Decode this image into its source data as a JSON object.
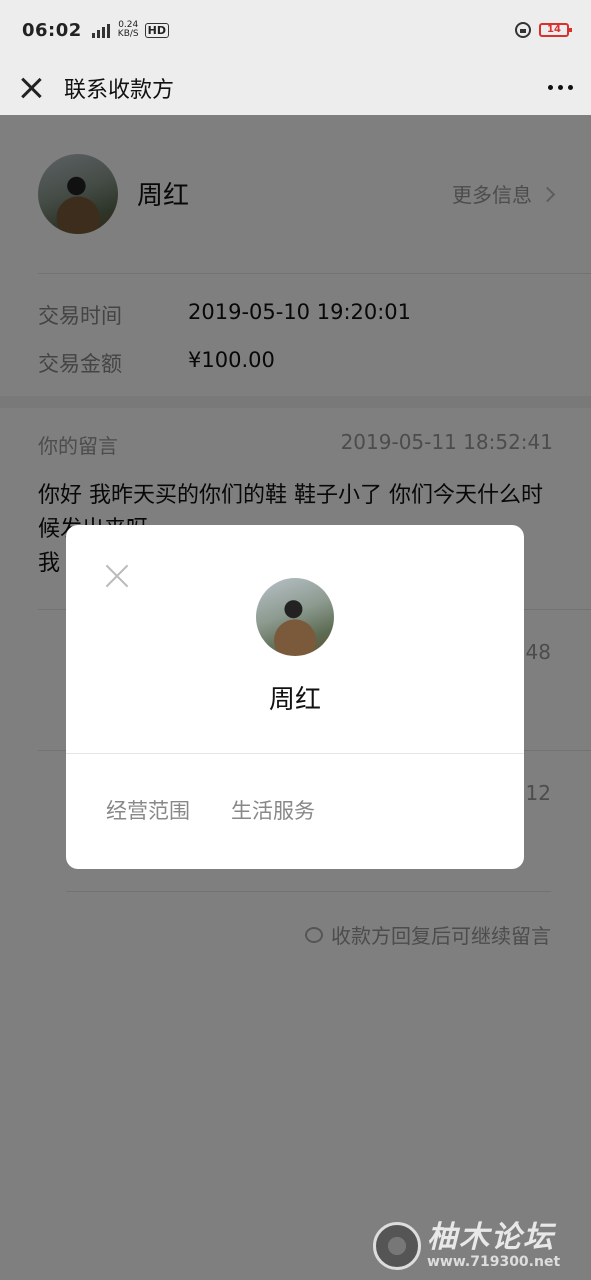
{
  "status_bar": {
    "time": "06:02",
    "network_type": "4G",
    "speed": "0.24",
    "speed_unit": "KB/S",
    "hd_label": "HD",
    "battery": "14"
  },
  "nav": {
    "title": "联系收款方"
  },
  "payee": {
    "name": "周红",
    "more_info": "更多信息"
  },
  "transaction": {
    "time_label": "交易时间",
    "time_value": "2019-05-10 19:20:01",
    "amount_label": "交易金额",
    "amount_value": "¥100.00"
  },
  "message": {
    "label": "你的留言",
    "timestamp": "2019-05-11 18:52:41",
    "text": "你好 我昨天买的你们的鞋 鞋子小了 你们今天什么时候发出来呀",
    "visible_partial_line": "我"
  },
  "reply_times": {
    "first_visible": "48",
    "second_visible": ":12"
  },
  "hint": "收款方回复后可继续留言",
  "modal": {
    "name": "周红",
    "business_label": "经营范围",
    "business_value": "生活服务"
  },
  "watermark": {
    "title": "柚木论坛",
    "url": "www.719300.net"
  },
  "colors": {
    "status_bg": "#ededed",
    "overlay": "rgba(0,0,0,0.5)",
    "battery_low": "#d9322e"
  }
}
